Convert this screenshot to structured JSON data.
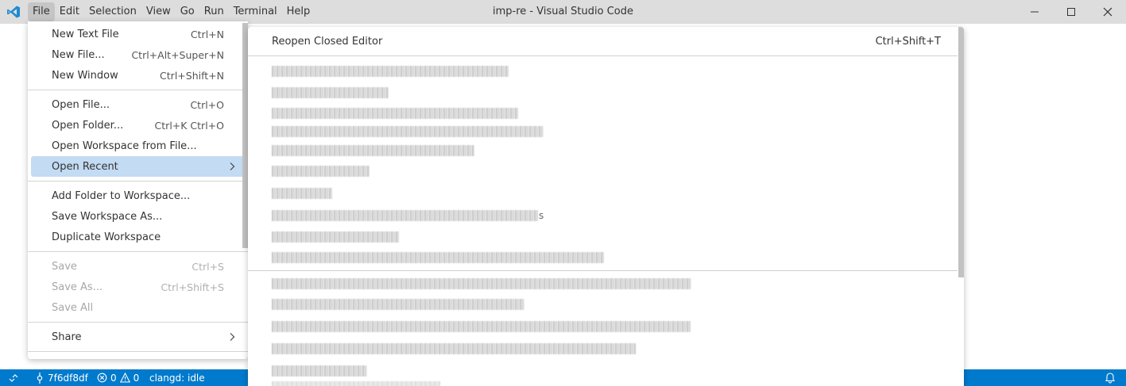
{
  "window": {
    "title": "imp-re - Visual Studio Code",
    "accent_color": "#007acc",
    "logo_icon": "vscode-logo-icon"
  },
  "menubar": [
    "File",
    "Edit",
    "Selection",
    "View",
    "Go",
    "Run",
    "Terminal",
    "Help"
  ],
  "file_menu": {
    "items": [
      {
        "label": "New Text File",
        "shortcut": "Ctrl+N"
      },
      {
        "label": "New File...",
        "shortcut": "Ctrl+Alt+Super+N"
      },
      {
        "label": "New Window",
        "shortcut": "Ctrl+Shift+N"
      },
      {
        "label": "Open File...",
        "shortcut": "Ctrl+O"
      },
      {
        "label": "Open Folder...",
        "shortcut": "Ctrl+K Ctrl+O"
      },
      {
        "label": "Open Workspace from File...",
        "shortcut": ""
      },
      {
        "label": "Open Recent",
        "shortcut": ""
      },
      {
        "label": "Add Folder to Workspace...",
        "shortcut": ""
      },
      {
        "label": "Save Workspace As...",
        "shortcut": ""
      },
      {
        "label": "Duplicate Workspace",
        "shortcut": ""
      },
      {
        "label": "Save",
        "shortcut": "Ctrl+S"
      },
      {
        "label": "Save As...",
        "shortcut": "Ctrl+Shift+S"
      },
      {
        "label": "Save All",
        "shortcut": ""
      },
      {
        "label": "Share",
        "shortcut": ""
      }
    ]
  },
  "open_recent": {
    "reopen_label": "Reopen Closed Editor",
    "reopen_shortcut": "Ctrl+Shift+T",
    "item_9_suffix": "s",
    "items_blurred": true
  },
  "statusbar": {
    "branch": "7f6df8df",
    "errors": "0",
    "warnings": "0",
    "clangd": "clangd: idle"
  }
}
